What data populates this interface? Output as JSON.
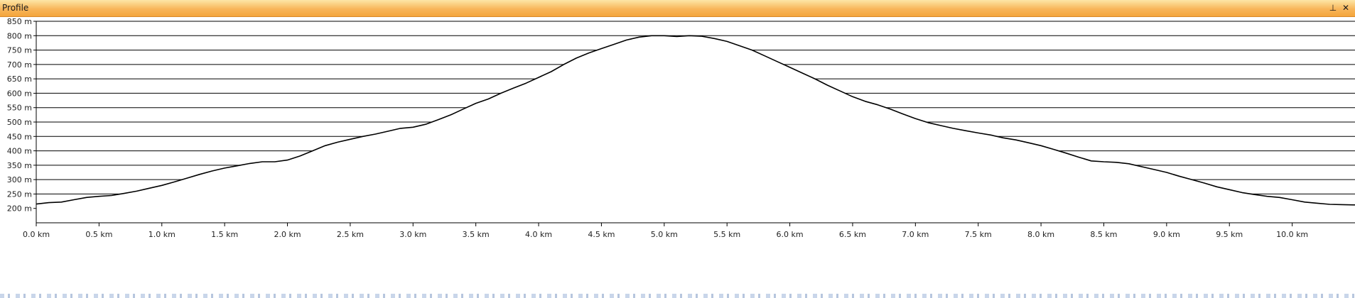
{
  "window": {
    "title": "Profile",
    "pin_icon": "pin-icon",
    "pin_glyph": "⊥",
    "close_icon": "close-icon",
    "close_glyph": "✕"
  },
  "chart_data": {
    "type": "area",
    "title": "",
    "xlabel": "",
    "ylabel": "",
    "xlim": [
      0,
      10.5
    ],
    "ylim": [
      150,
      850
    ],
    "grid": "horizontal",
    "x_ticks": [
      0,
      0.5,
      1,
      1.5,
      2,
      2.5,
      3,
      3.5,
      4,
      4.5,
      5,
      5.5,
      6,
      6.5,
      7,
      7.5,
      8,
      8.5,
      9,
      9.5,
      10
    ],
    "x_tick_labels": [
      "0.0 km",
      "0.5 km",
      "1.0 km",
      "1.5 km",
      "2.0 km",
      "2.5 km",
      "3.0 km",
      "3.5 km",
      "4.0 km",
      "4.5 km",
      "5.0 km",
      "5.5 km",
      "6.0 km",
      "6.5 km",
      "7.0 km",
      "7.5 km",
      "8.0 km",
      "8.5 km",
      "9.0 km",
      "9.5 km",
      "10.0 km"
    ],
    "y_ticks": [
      200,
      250,
      300,
      350,
      400,
      450,
      500,
      550,
      600,
      650,
      700,
      750,
      800,
      850
    ],
    "y_tick_labels": [
      "200 m",
      "250 m",
      "300 m",
      "350 m",
      "400 m",
      "450 m",
      "500 m",
      "550 m",
      "600 m",
      "650 m",
      "700 m",
      "750 m",
      "800 m",
      "850 m"
    ],
    "colors": {
      "line": "#000000",
      "fill": "#ffffff",
      "grid": "#000000"
    },
    "series": [
      {
        "x": [
          0,
          0.1,
          0.2,
          0.3,
          0.4,
          0.5,
          0.6,
          0.7,
          0.8,
          0.9,
          1.0,
          1.1,
          1.2,
          1.3,
          1.4,
          1.5,
          1.6,
          1.7,
          1.8,
          1.9,
          2.0,
          2.1,
          2.2,
          2.3,
          2.4,
          2.5,
          2.6,
          2.7,
          2.8,
          2.9,
          3.0,
          3.1,
          3.2,
          3.3,
          3.4,
          3.5,
          3.6,
          3.7,
          3.8,
          3.9,
          4.0,
          4.1,
          4.2,
          4.3,
          4.4,
          4.5,
          4.6,
          4.7,
          4.8,
          4.9,
          5.0,
          5.1,
          5.2,
          5.3,
          5.4,
          5.5,
          5.6,
          5.7,
          5.8,
          5.9,
          6.0,
          6.1,
          6.2,
          6.3,
          6.4,
          6.5,
          6.6,
          6.7,
          6.8,
          6.9,
          7.0,
          7.1,
          7.2,
          7.3,
          7.4,
          7.5,
          7.6,
          7.7,
          7.8,
          7.9,
          8.0,
          8.1,
          8.2,
          8.3,
          8.4,
          8.5,
          8.6,
          8.7,
          8.8,
          8.9,
          9.0,
          9.1,
          9.2,
          9.3,
          9.4,
          9.5,
          9.6,
          9.7,
          9.8,
          9.9,
          10.0,
          10.1,
          10.2,
          10.3,
          10.4,
          10.5
        ],
        "y": [
          215,
          220,
          222,
          230,
          238,
          242,
          245,
          252,
          260,
          270,
          280,
          292,
          305,
          318,
          330,
          340,
          348,
          356,
          362,
          362,
          368,
          382,
          400,
          418,
          430,
          440,
          450,
          458,
          468,
          478,
          482,
          492,
          508,
          525,
          545,
          565,
          580,
          600,
          618,
          635,
          655,
          675,
          700,
          722,
          740,
          755,
          770,
          785,
          795,
          800,
          800,
          797,
          800,
          798,
          790,
          780,
          765,
          750,
          730,
          710,
          690,
          670,
          650,
          628,
          608,
          588,
          572,
          560,
          545,
          528,
          512,
          498,
          488,
          478,
          470,
          462,
          455,
          445,
          438,
          428,
          418,
          405,
          392,
          378,
          365,
          362,
          360,
          355,
          345,
          335,
          325,
          312,
          300,
          288,
          275,
          265,
          255,
          248,
          242,
          238,
          230,
          222,
          218,
          214,
          213,
          212
        ]
      }
    ]
  }
}
